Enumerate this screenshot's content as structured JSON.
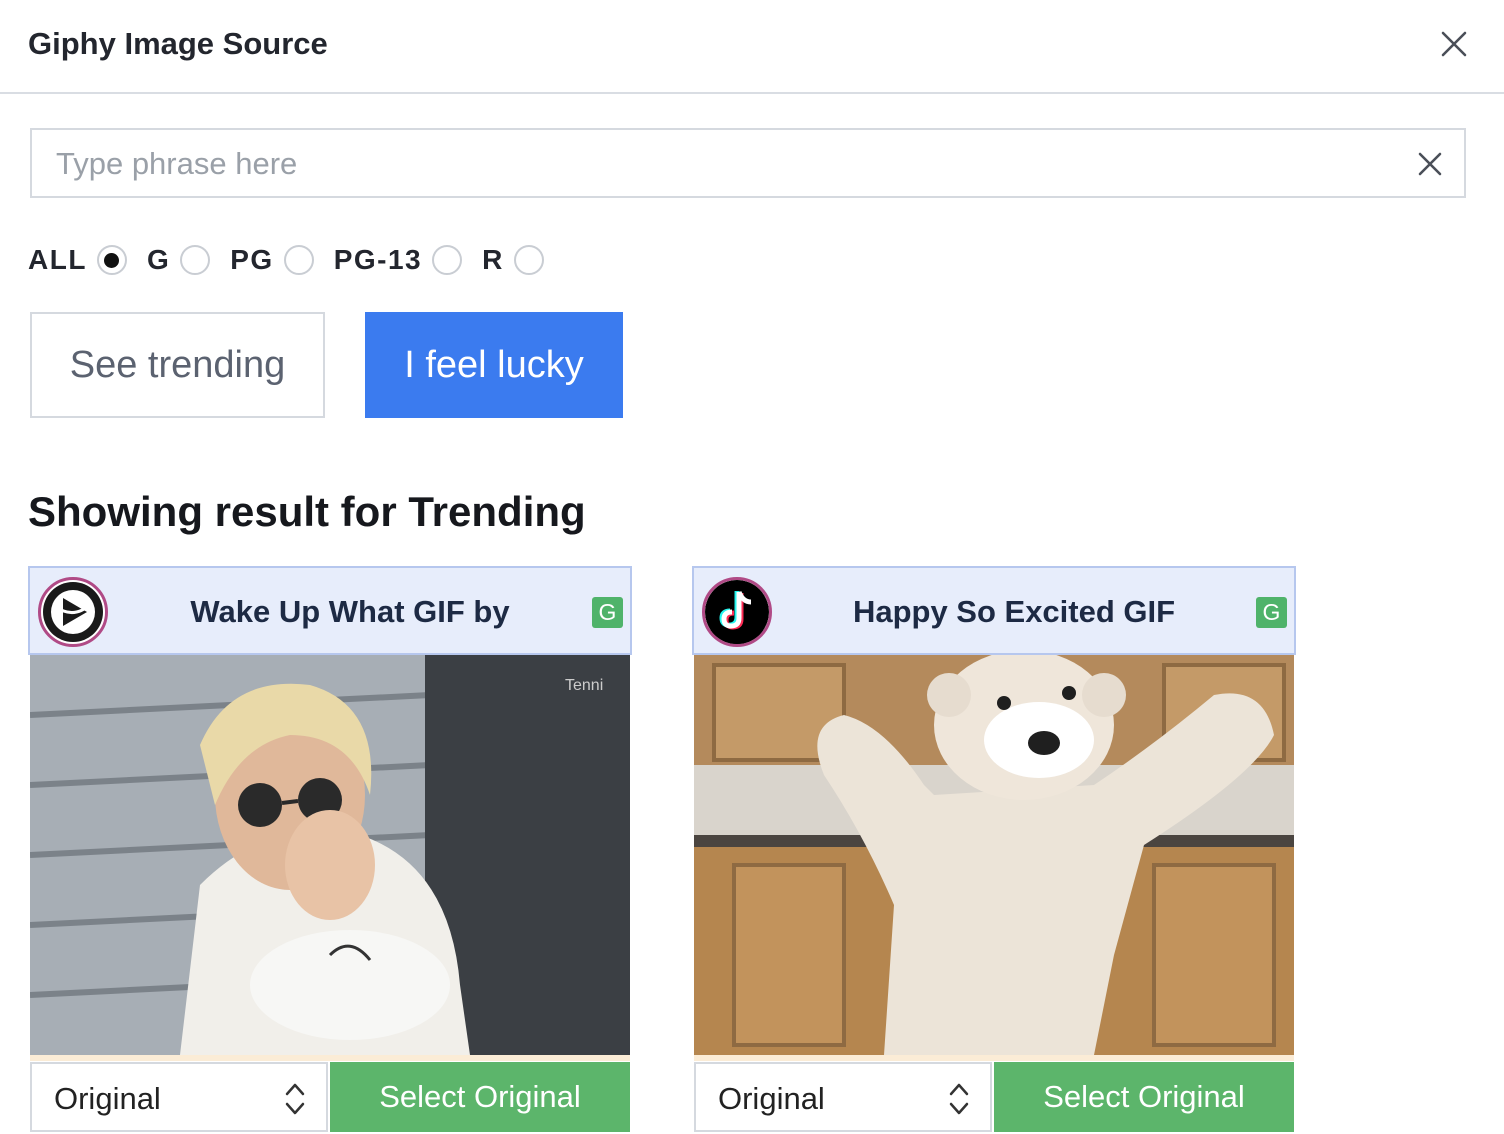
{
  "dialog": {
    "title": "Giphy Image Source"
  },
  "search": {
    "placeholder": "Type phrase here",
    "value": ""
  },
  "ratings": [
    {
      "label": "ALL",
      "checked": true
    },
    {
      "label": "G",
      "checked": false
    },
    {
      "label": "PG",
      "checked": false
    },
    {
      "label": "PG-13",
      "checked": false
    },
    {
      "label": "R",
      "checked": false
    }
  ],
  "buttons": {
    "trending": "See trending",
    "lucky": "I feel lucky"
  },
  "results": {
    "heading": "Showing result for Trending",
    "items": [
      {
        "title": "Wake Up What GIF by",
        "rating": "G",
        "avatar_icon": "tennis-channel-icon",
        "size_option": "Original",
        "select_label": "Select Original"
      },
      {
        "title": "Happy So Excited GIF",
        "rating": "G",
        "avatar_icon": "tiktok-icon",
        "size_option": "Original",
        "select_label": "Select Original"
      }
    ]
  },
  "colors": {
    "accent_blue": "#3b7bef",
    "select_green": "#5cb56b",
    "badge_green": "#4fb36a",
    "card_header_bg": "#e7edfb"
  }
}
